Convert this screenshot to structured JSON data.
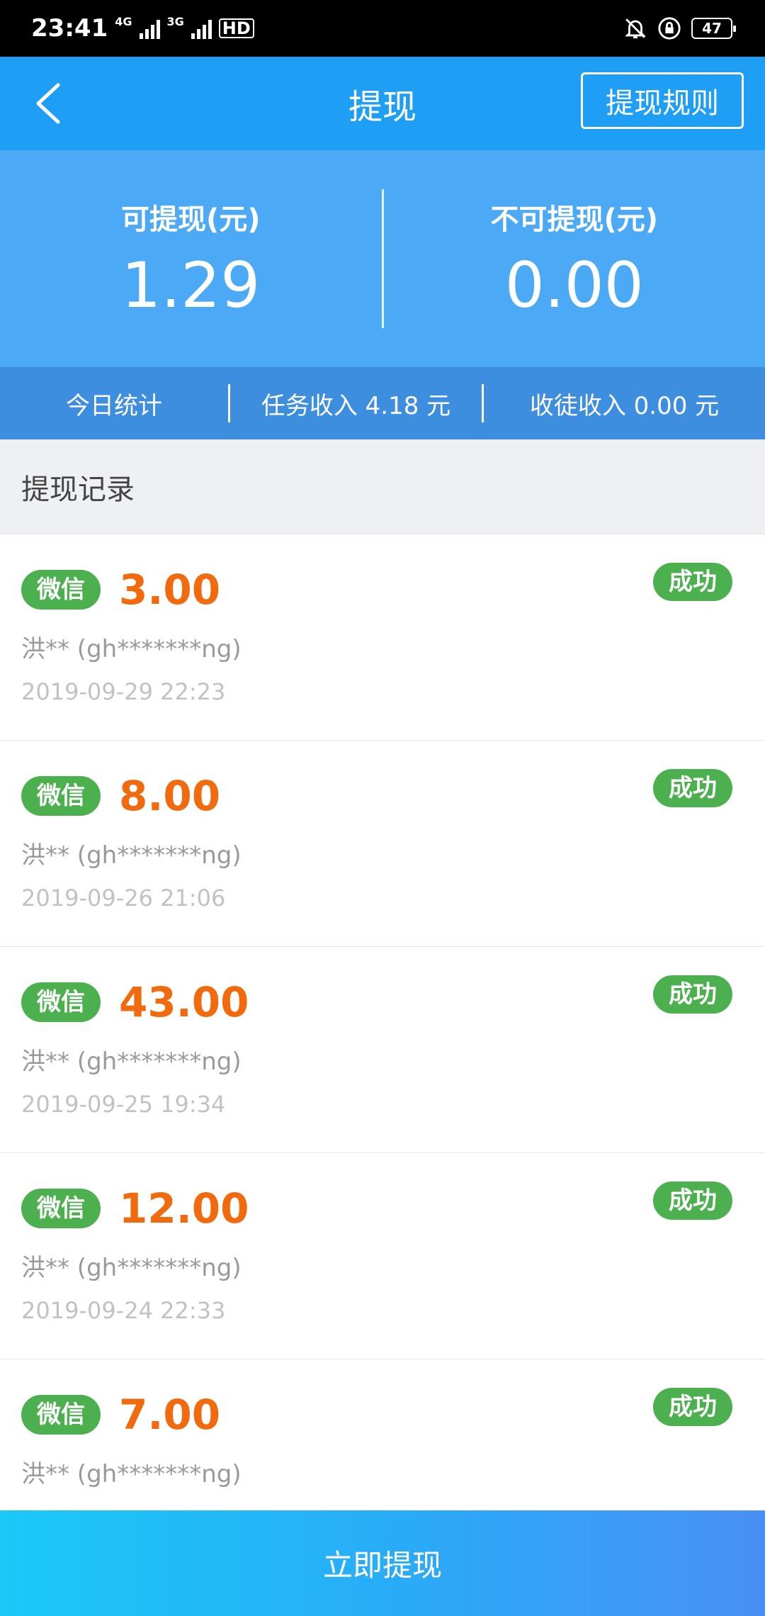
{
  "status_bar": {
    "time": "23:41",
    "net1": "4G",
    "net2": "3G",
    "hd": "HD",
    "battery": "47"
  },
  "nav": {
    "title": "提现",
    "rules_label": "提现规则"
  },
  "balance": {
    "available_label": "可提现(元)",
    "available_value": "1.29",
    "unavailable_label": "不可提现(元)",
    "unavailable_value": "0.00"
  },
  "stats": {
    "today": "今日统计",
    "task_income": "任务收入 4.18 元",
    "apprentice_income": "收徒收入 0.00 元"
  },
  "records_title": "提现记录",
  "records": [
    {
      "channel": "微信",
      "amount": "3.00",
      "status": "成功",
      "account": "洪**  (gh*******ng)",
      "time": "2019-09-29 22:23"
    },
    {
      "channel": "微信",
      "amount": "8.00",
      "status": "成功",
      "account": "洪**  (gh*******ng)",
      "time": "2019-09-26 21:06"
    },
    {
      "channel": "微信",
      "amount": "43.00",
      "status": "成功",
      "account": "洪**  (gh*******ng)",
      "time": "2019-09-25 19:34"
    },
    {
      "channel": "微信",
      "amount": "12.00",
      "status": "成功",
      "account": "洪**  (gh*******ng)",
      "time": "2019-09-24 22:33"
    },
    {
      "channel": "微信",
      "amount": "7.00",
      "status": "成功",
      "account": "洪**  (gh*******ng)",
      "time": ""
    }
  ],
  "withdraw_button": "立即提现",
  "colors": {
    "nav": "#1e9ef4",
    "balance_panel": "#4ca9f6",
    "stats_bar": "#3e8ee0",
    "amount": "#f26a0e",
    "badge_green": "#4cb04f"
  }
}
